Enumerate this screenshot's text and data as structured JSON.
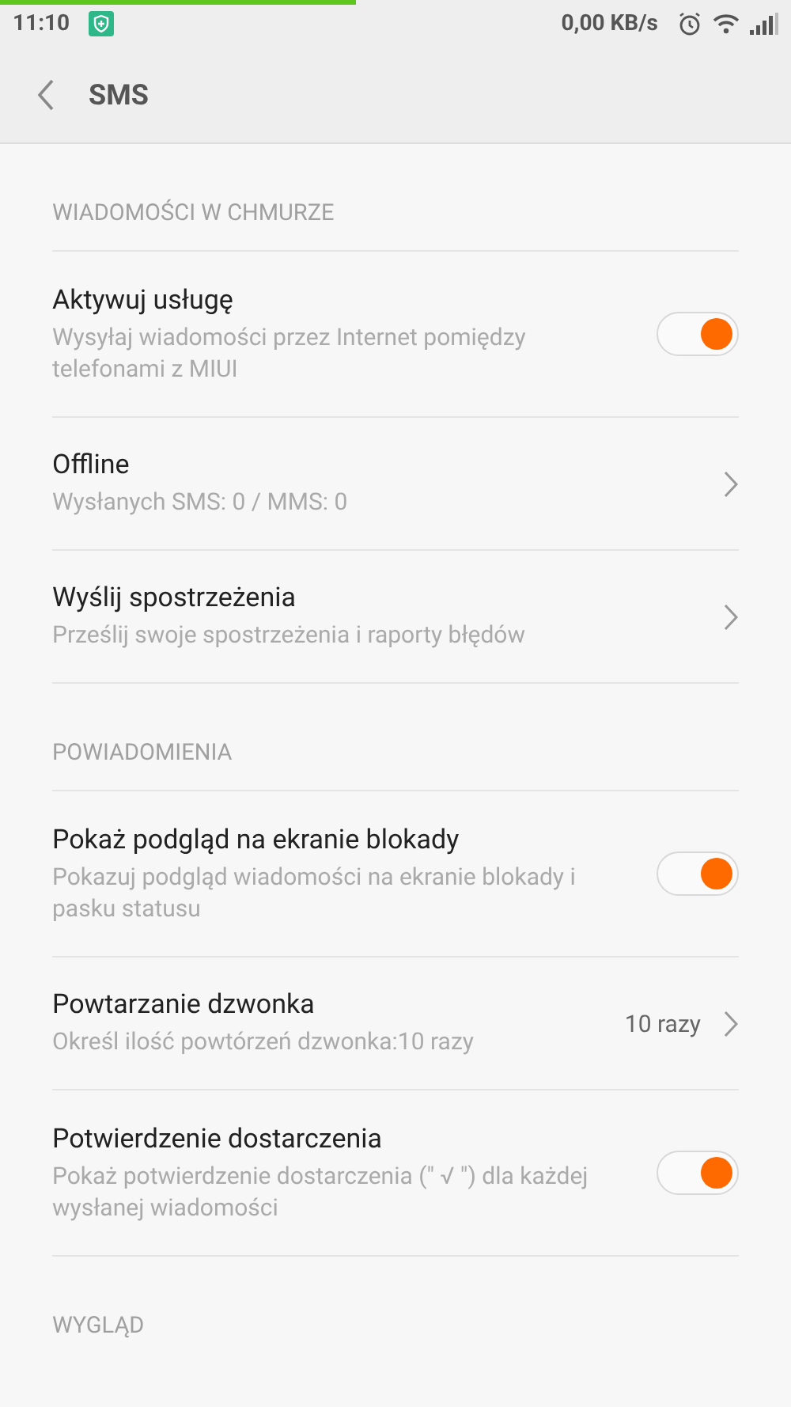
{
  "status_bar": {
    "time": "11:10",
    "speed": "0,00 KB/s"
  },
  "progress_bar": {
    "level": 0.45
  },
  "header": {
    "title": "SMS"
  },
  "sections": [
    {
      "title": "WIADOMOŚCI W CHMURZE",
      "items": [
        {
          "kind": "toggle",
          "title": "Aktywuj usługę",
          "subtitle": "Wysyłaj wiadomości przez Internet pomiędzy telefonami z MIUI",
          "on": true
        },
        {
          "kind": "link",
          "title": "Offline",
          "subtitle": "Wysłanych SMS: 0 / MMS: 0"
        },
        {
          "kind": "link",
          "title": "Wyślij spostrzeżenia",
          "subtitle": "Prześlij swoje spostrzeżenia i raporty błędów"
        }
      ]
    },
    {
      "title": "POWIADOMIENIA",
      "items": [
        {
          "kind": "toggle",
          "title": "Pokaż podgląd na ekranie blokady",
          "subtitle": "Pokazuj podgląd wiadomości na ekranie blokady i pasku statusu",
          "on": true
        },
        {
          "kind": "link",
          "title": "Powtarzanie dzwonka",
          "subtitle": "Określ ilość powtórzeń dzwonka:10 razy",
          "value": "10 razy"
        },
        {
          "kind": "toggle",
          "title": "Potwierdzenie dostarczenia",
          "subtitle": "Pokaż potwierdzenie dostarczenia (\" √ \") dla każdej wysłanej wiadomości",
          "on": true
        }
      ]
    },
    {
      "title": "WYGLĄD"
    }
  ]
}
